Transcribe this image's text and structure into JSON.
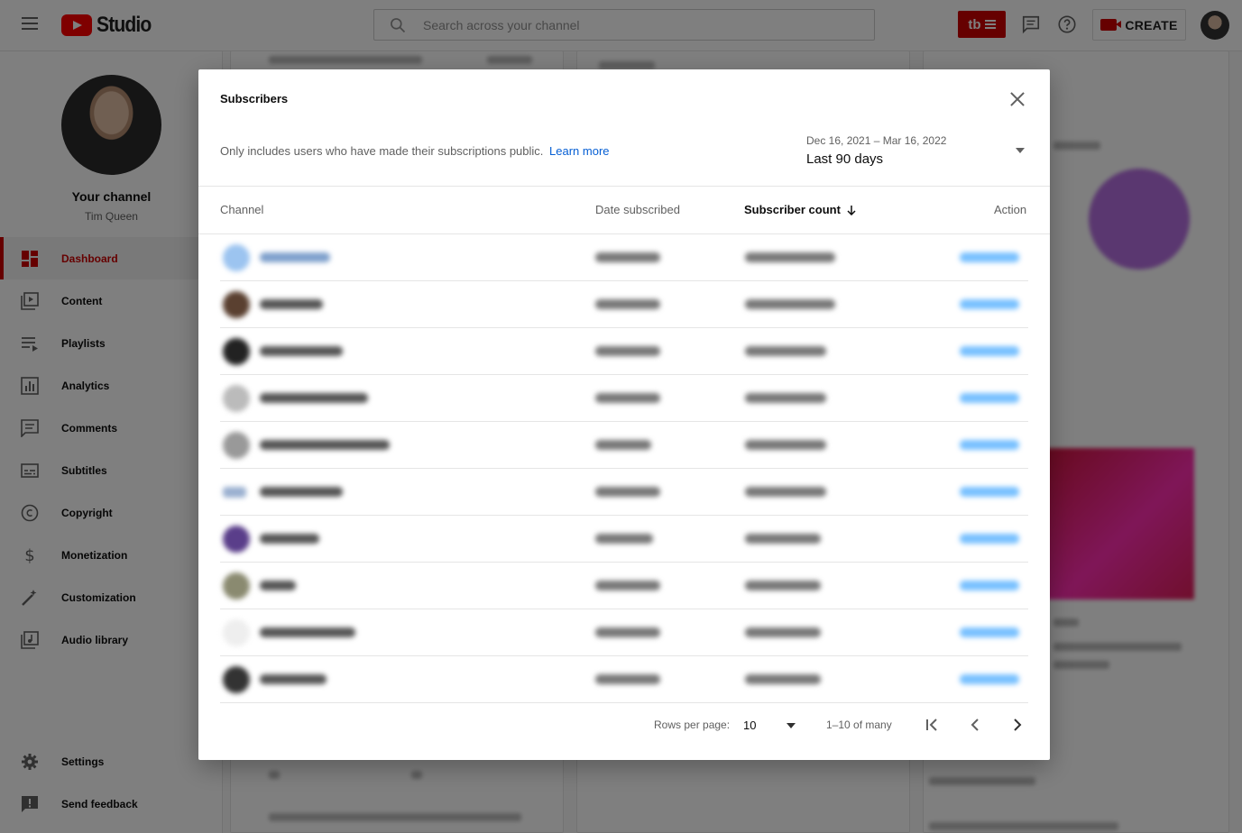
{
  "app": {
    "name": "Studio"
  },
  "search": {
    "placeholder": "Search across your channel"
  },
  "header": {
    "badge_text": "tb",
    "create_label": "CREATE"
  },
  "sidebar": {
    "channel_title": "Your channel",
    "channel_name": "Tim Queen",
    "items": [
      {
        "label": "Dashboard",
        "icon": "dashboard-icon",
        "active": true
      },
      {
        "label": "Content",
        "icon": "content-icon"
      },
      {
        "label": "Playlists",
        "icon": "playlists-icon"
      },
      {
        "label": "Analytics",
        "icon": "analytics-icon"
      },
      {
        "label": "Comments",
        "icon": "comments-icon"
      },
      {
        "label": "Subtitles",
        "icon": "subtitles-icon"
      },
      {
        "label": "Copyright",
        "icon": "copyright-icon"
      },
      {
        "label": "Monetization",
        "icon": "dollar-icon"
      },
      {
        "label": "Customization",
        "icon": "magic-wand-icon"
      },
      {
        "label": "Audio library",
        "icon": "audio-library-icon"
      }
    ],
    "bottom_items": [
      {
        "label": "Settings",
        "icon": "gear-icon"
      },
      {
        "label": "Send feedback",
        "icon": "feedback-icon"
      }
    ]
  },
  "modal": {
    "title": "Subscribers",
    "description": "Only includes users who have made their subscriptions public.",
    "learn_more": "Learn more",
    "date_range": "Dec 16, 2021 – Mar 16, 2022",
    "date_preset": "Last 90 days",
    "columns": {
      "channel": "Channel",
      "date_subscribed": "Date subscribed",
      "subscriber_count": "Subscriber count",
      "action": "Action"
    },
    "rows_blurred_count": 10,
    "footer": {
      "rows_per_page_label": "Rows per page:",
      "rows_per_page_value": "10",
      "range_label": "1–10 of many"
    }
  },
  "colors": {
    "brand_red": "#ff0000",
    "accent_red": "#cc0000",
    "link_blue": "#065fd4",
    "action_blue": "#3ea6ff"
  }
}
